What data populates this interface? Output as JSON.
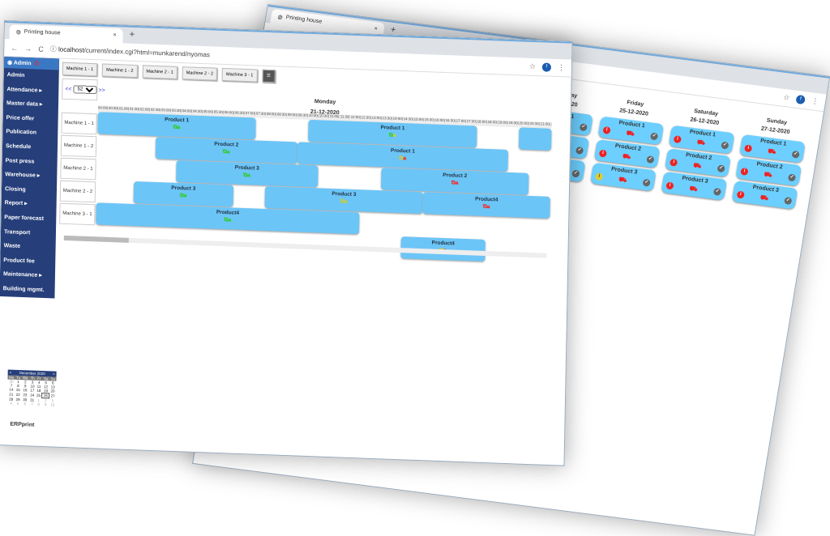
{
  "browser": {
    "tab_title": "Printing house",
    "url_host": "localhost",
    "url_path": "/current/index.cgi?html=munkarend/nyomas",
    "avatar": "f"
  },
  "back": {
    "days": [
      {
        "name": "Thursday",
        "date": "24-12-2020",
        "cards": [
          {
            "label": "Product 1",
            "info": "red"
          },
          {
            "label": "Product 2",
            "info": "red"
          },
          {
            "label": "Product 3",
            "info": "red"
          }
        ]
      },
      {
        "name": "Friday",
        "date": "25-12-2020",
        "cards": [
          {
            "label": "Product 1",
            "info": "red"
          },
          {
            "label": "Product 2",
            "info": "red"
          },
          {
            "label": "Product 3",
            "info": "yellow"
          }
        ]
      },
      {
        "name": "Saturday",
        "date": "26-12-2020",
        "cards": [
          {
            "label": "Product 1",
            "info": "red"
          },
          {
            "label": "Product 2",
            "info": "red"
          },
          {
            "label": "Product 3",
            "info": "red"
          }
        ]
      },
      {
        "name": "Sunday",
        "date": "27-12-2020",
        "cards": [
          {
            "label": "Product 1",
            "info": "red"
          },
          {
            "label": "Product 2",
            "info": "red"
          },
          {
            "label": "Product 3",
            "info": "red"
          }
        ]
      }
    ]
  },
  "sidebar": {
    "user": "Admin",
    "items": [
      "Admin",
      "Attendance ▸",
      "Master data ▸",
      "Price offer",
      "Publication",
      "Schedule",
      "Post press",
      "Warehouse ▸",
      "Closing",
      "Report ▸",
      "Paper forecast",
      "Transport",
      "Waste",
      "Product fee",
      "Maintenance ▸",
      "Building mgmt."
    ]
  },
  "machines": [
    "Machine 1 - 1",
    "Machine 1 - 2",
    "Machine 2 - 1",
    "Machine 2 - 2",
    "Machine 3 - 1"
  ],
  "nav": {
    "prev": "<<",
    "week": "52",
    "next": ">>"
  },
  "day": {
    "name": "Monday",
    "date": "21-12-2020"
  },
  "colors": {
    "green": "#3c3",
    "yellow": "#cc3",
    "red": "#e33",
    "bar": "#6cc5f7"
  },
  "jobs": [
    {
      "machine": 0,
      "lane": 0,
      "label": "Product 1",
      "start": "00:00",
      "end": "07:30",
      "copy": "green",
      "lock": "green"
    },
    {
      "machine": 0,
      "lane": 0,
      "label": "Product 1",
      "start": "10:00",
      "end": "18:00",
      "copy": "green",
      "lock": "yellow"
    },
    {
      "machine": 0,
      "lane": 0,
      "label": "",
      "start": "20:00",
      "end": "22:00",
      "copy": "",
      "lock": ""
    },
    {
      "machine": 1,
      "lane": 0,
      "label": "Product 2",
      "start": "02:45",
      "end": "09:30",
      "copy": "green",
      "lock": "green"
    },
    {
      "machine": 1,
      "lane": 0,
      "label": "Product 1",
      "start": "09:30",
      "end": "19:30",
      "copy": "yellow",
      "lock": "red"
    },
    {
      "machine": 2,
      "lane": 0,
      "label": "Product 3",
      "start": "03:45",
      "end": "10:30",
      "copy": "green",
      "lock": "green"
    },
    {
      "machine": 2,
      "lane": 0,
      "label": "Product 2",
      "start": "13:30",
      "end": "20:30",
      "copy": "red",
      "lock": "red"
    },
    {
      "machine": 3,
      "lane": 0,
      "label": "Product 3",
      "start": "01:45",
      "end": "06:30",
      "copy": "green",
      "lock": "green"
    },
    {
      "machine": 3,
      "lane": 0,
      "label": "Product 3",
      "start": "08:00",
      "end": "15:30",
      "copy": "yellow",
      "lock": "yellow"
    },
    {
      "machine": 3,
      "lane": 0,
      "label": "Product4",
      "start": "15:30",
      "end": "22:00",
      "copy": "red",
      "lock": "red"
    },
    {
      "machine": 4,
      "lane": 0,
      "label": "Product4",
      "start": "00:00",
      "end": "12:30",
      "copy": "green",
      "lock": "green"
    },
    {
      "machine": 4,
      "lane": 1,
      "label": "Product4",
      "start": "14:30",
      "end": "18:30",
      "copy": "yellow",
      "lock": "red"
    }
  ],
  "calendar": {
    "title": "December 2020",
    "prev": "<",
    "next": ">",
    "weekdays": [
      "Mo",
      "Tu",
      "We",
      "Th",
      "Fr",
      "Sa",
      "Su"
    ],
    "weeks": [
      [
        "30",
        "1",
        "2",
        "3",
        "4",
        "5",
        "6"
      ],
      [
        "7",
        "8",
        "9",
        "10",
        "11",
        "12",
        "13"
      ],
      [
        "14",
        "15",
        "16",
        "17",
        "18",
        "19",
        "20"
      ],
      [
        "21",
        "22",
        "23",
        "24",
        "25",
        "26",
        "27"
      ],
      [
        "28",
        "29",
        "30",
        "31",
        "1",
        "2",
        "3"
      ],
      [
        "4",
        "5",
        "6",
        "7",
        "8",
        "9",
        "10"
      ]
    ],
    "selected": "26"
  },
  "brand": "ERPprint"
}
